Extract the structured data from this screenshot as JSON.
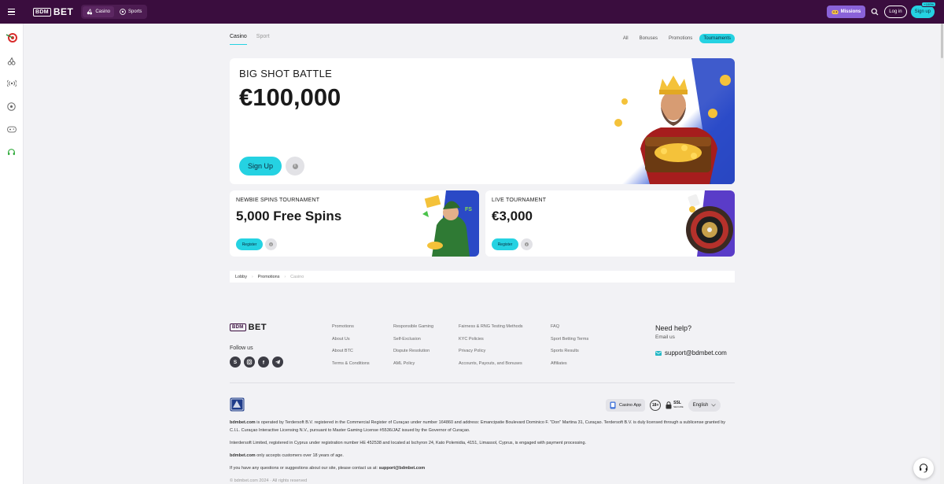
{
  "brand": {
    "box_text": "BDM",
    "word": "BET"
  },
  "topnav": {
    "items": [
      {
        "label": "Casino",
        "icon": "cherries-icon"
      },
      {
        "label": "Sports",
        "icon": "soccer-icon"
      }
    ]
  },
  "header": {
    "missions_label": "Missions",
    "login_label": "Log in",
    "signup_label": "Sign up",
    "signup_badge": "+100%"
  },
  "sidebar": {
    "icons": [
      "dartboard-icon",
      "cherries-icon",
      "live-broadcast-icon",
      "soccer-ball-icon",
      "gamepad-icon",
      "headset-icon"
    ]
  },
  "tabs": {
    "casino": "Casino",
    "sport": "Sport"
  },
  "filters": {
    "all": "All",
    "bonuses": "Bonuses",
    "promotions": "Promotions",
    "tournaments": "Tournaments"
  },
  "hero": {
    "subtitle": "BIG SHOT BATTLE",
    "amount": "€100,000",
    "signup_label": "Sign Up"
  },
  "cards": [
    {
      "subtitle": "NEWBIE SPINS TOURNAMENT",
      "title": "5,000 Free Spins",
      "button": "Register"
    },
    {
      "subtitle": "LIVE TOURNAMENT",
      "title": "€3,000",
      "button": "Register"
    }
  ],
  "breadcrumb": {
    "items": [
      "Lobby",
      "Promotions",
      "Casino"
    ]
  },
  "footer": {
    "follow_label": "Follow us",
    "col1": [
      "Promotions",
      "About Us",
      "About BTC",
      "Terms & Conditions"
    ],
    "col2": [
      "Responsible Gaming",
      "Self-Exclusion",
      "Dispute Resolution",
      "AML Policy"
    ],
    "col3": [
      "Fairness & RNG Testing Methods",
      "KYC Policies",
      "Privacy Policy",
      "Accounts, Payouts, and Bonuses"
    ],
    "col4": [
      "FAQ",
      "Sport Betting Terms",
      "Sports Results",
      "Affiliates"
    ],
    "help_title": "Need help?",
    "help_sub": "Email us",
    "email": "support@bdmbet.com"
  },
  "badges": {
    "casino_app": "Casino App",
    "age": "18+",
    "ssl": "SSL",
    "ssl_sub": "SECURE",
    "language": "English"
  },
  "legal": {
    "p1_brand": "bdmbet.com",
    "p1": " is operated by Terdersoft B.V. registered in the Commercial Register of Curaçao under number 164860 and address: Emancipatie Boulevard Dominico F. \"Don\" Martina 31, Curaçao. Terdersoft B.V. is duly licensed through a sublicense granted by C.I.L. Curaçao Interactive Licensing N.V., pursuant to Master Gaming License #5536/JAZ issued by the Governor of Curaçao.",
    "p2": "Interdersoft Limited, registered in Cyprus under registration number HE 452538 and located at Ischyron 24, Kato Polemidia, 4151, Limassol, Cyprus, is engaged with payment processing.",
    "p3_brand": "bdmbet.com",
    "p3": " only accepts customers over 18 years of age.",
    "p4": "If you have any questions or suggestions about our site, please contact us at: ",
    "p4_email": "support@bdmbet.com",
    "copyright": "© bdmbet.com 2024 · All rights reserved"
  },
  "colors": {
    "topbar": "#3a0d3e",
    "accent": "#25d2e2",
    "missions": "#8a62d8"
  }
}
